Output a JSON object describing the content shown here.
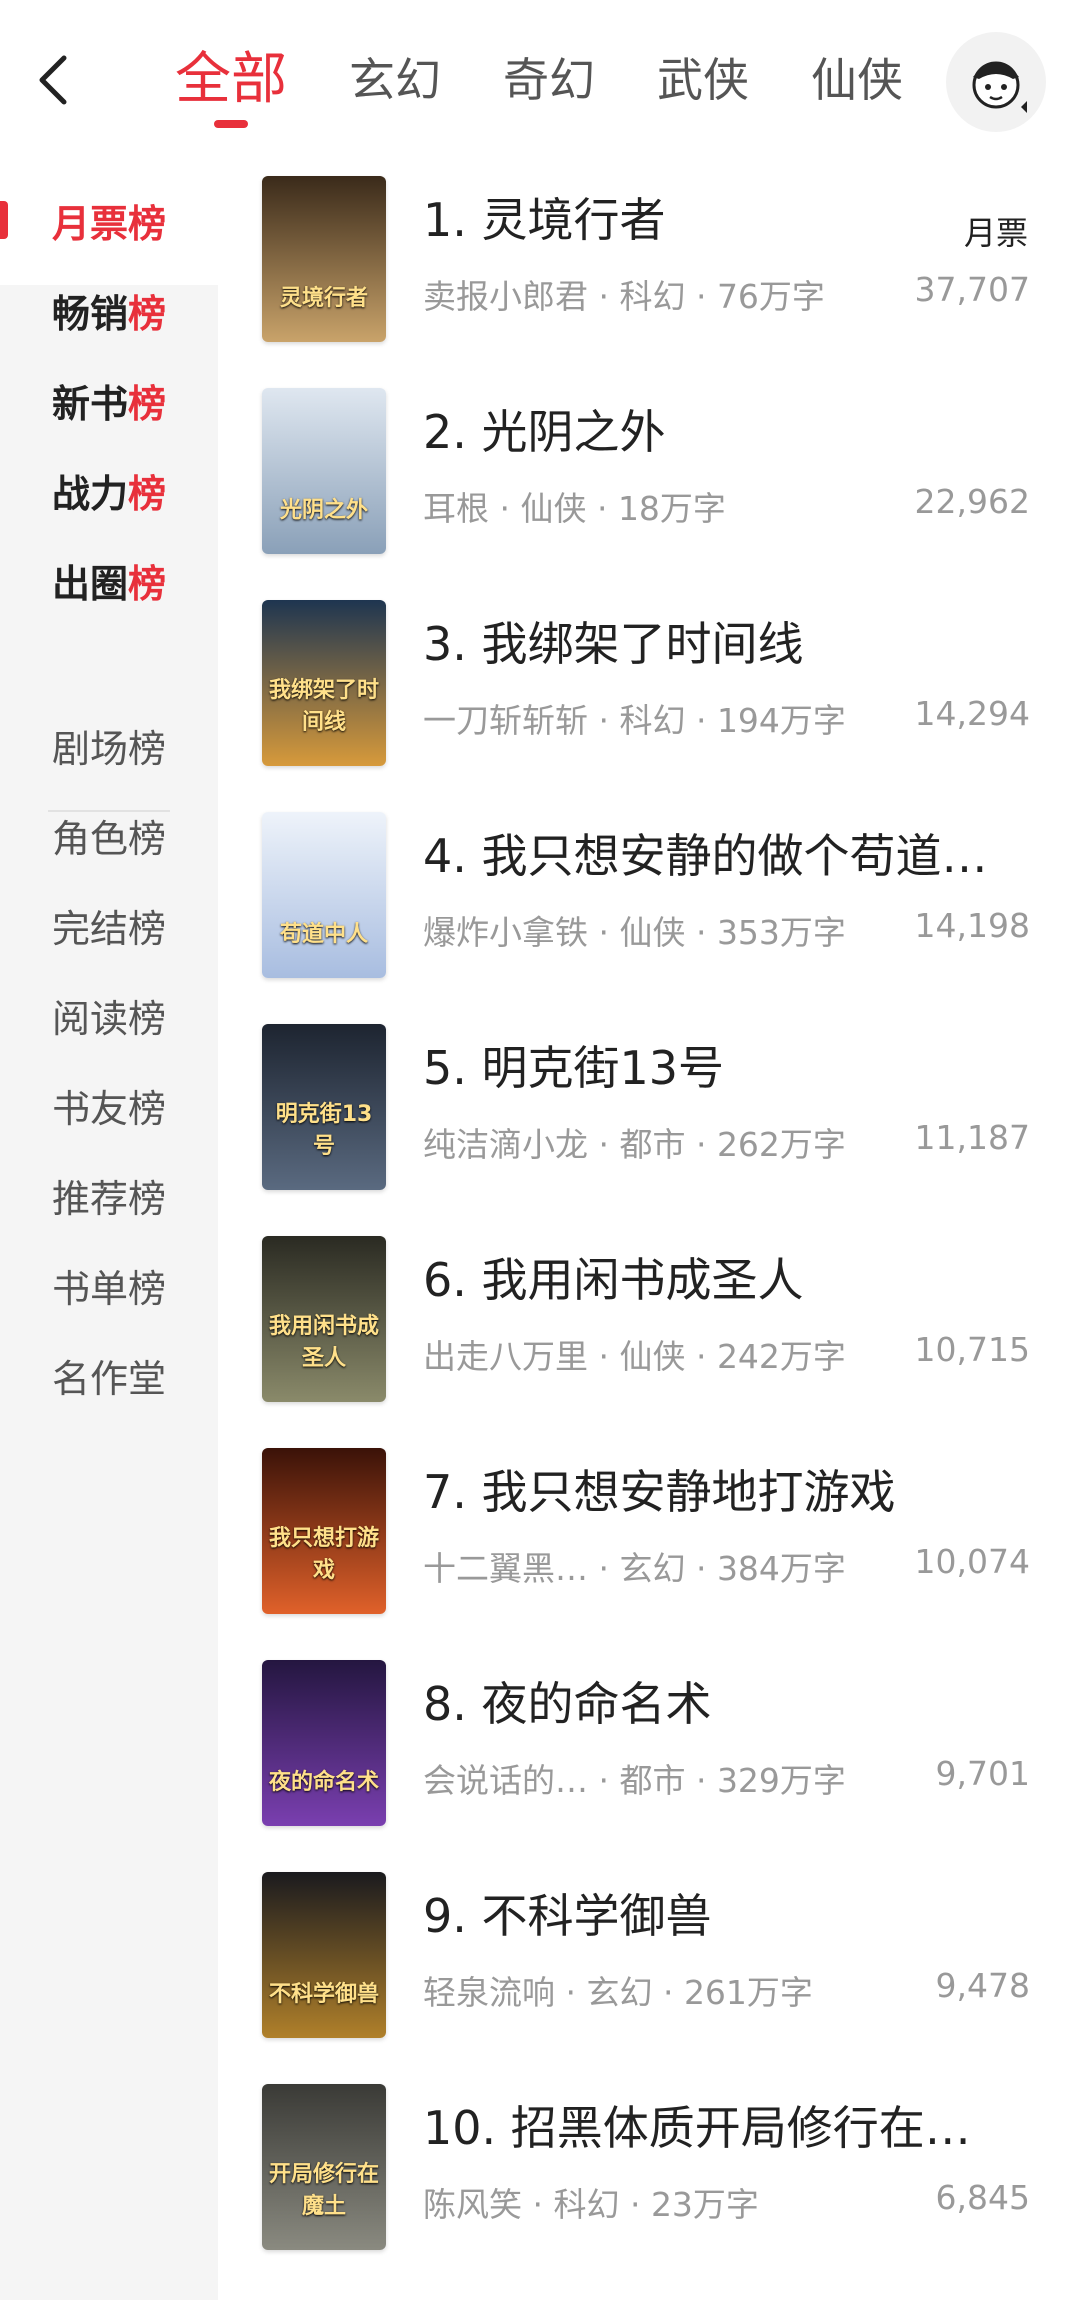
{
  "header": {
    "tabs": [
      "全部",
      "玄幻",
      "奇幻",
      "武侠",
      "仙侠"
    ],
    "active_tab": 0
  },
  "sidebar": {
    "items": [
      {
        "label": "月票",
        "suffix": "榜",
        "style": "active"
      },
      {
        "label": "畅销",
        "suffix": "榜",
        "style": "bold"
      },
      {
        "label": "新书",
        "suffix": "榜",
        "style": "bold"
      },
      {
        "label": "战力",
        "suffix": "榜",
        "style": "bold"
      },
      {
        "label": "出圈",
        "suffix": "榜",
        "style": "bold"
      },
      {
        "label": "剧场榜",
        "suffix": "",
        "style": "normal"
      },
      {
        "label": "角色榜",
        "suffix": "",
        "style": "normal"
      },
      {
        "label": "完结榜",
        "suffix": "",
        "style": "normal"
      },
      {
        "label": "阅读榜",
        "suffix": "",
        "style": "normal"
      },
      {
        "label": "书友榜",
        "suffix": "",
        "style": "normal"
      },
      {
        "label": "推荐榜",
        "suffix": "",
        "style": "normal"
      },
      {
        "label": "书单榜",
        "suffix": "",
        "style": "normal"
      },
      {
        "label": "名作堂",
        "suffix": "",
        "style": "normal"
      }
    ]
  },
  "list": {
    "votes_label": "月票",
    "books": [
      {
        "title": "1. 灵境行者",
        "meta": "卖报小郎君 · 科幻 · 76万字",
        "votes": "37,707",
        "cover_text": "灵境行者",
        "cover_colors": [
          "#3a2a1a",
          "#c9a36a"
        ]
      },
      {
        "title": "2. 光阴之外",
        "meta": "耳根 · 仙侠 · 18万字",
        "votes": "22,962",
        "cover_text": "光阴之外",
        "cover_colors": [
          "#dfe7f0",
          "#8aa0b8"
        ]
      },
      {
        "title": "3. 我绑架了时间线",
        "meta": "一刀斩斩斩 · 科幻 · 194万字",
        "votes": "14,294",
        "cover_text": "我绑架了时间线",
        "cover_colors": [
          "#1e3550",
          "#d79a3b"
        ]
      },
      {
        "title": "4. 我只想安静的做个苟道…",
        "meta": "爆炸小拿铁 · 仙侠 · 353万字",
        "votes": "14,198",
        "cover_text": "苟道中人",
        "cover_colors": [
          "#eef3fa",
          "#a8bde0"
        ]
      },
      {
        "title": "5. 明克街13号",
        "meta": "纯洁滴小龙 · 都市 · 262万字",
        "votes": "11,187",
        "cover_text": "明克街13号",
        "cover_colors": [
          "#1d2430",
          "#5a6a80"
        ]
      },
      {
        "title": "6. 我用闲书成圣人",
        "meta": "出走八万里 · 仙侠 · 242万字",
        "votes": "10,715",
        "cover_text": "我用闲书成圣人",
        "cover_colors": [
          "#2a2a22",
          "#8a8a6a"
        ]
      },
      {
        "title": "7. 我只想安静地打游戏",
        "meta": "十二翼黑… · 玄幻 · 384万字",
        "votes": "10,074",
        "cover_text": "我只想打游戏",
        "cover_colors": [
          "#3a1208",
          "#e0612a"
        ]
      },
      {
        "title": "8. 夜的命名术",
        "meta": "会说话的…  · 都市 · 329万字",
        "votes": "9,701",
        "cover_text": "夜的命名术",
        "cover_colors": [
          "#241640",
          "#7a3fb0"
        ]
      },
      {
        "title": "9. 不科学御兽",
        "meta": "轻泉流响 · 玄幻 · 261万字",
        "votes": "9,478",
        "cover_text": "不科学御兽",
        "cover_colors": [
          "#1a1a1e",
          "#b0802a"
        ]
      },
      {
        "title": "10. 招黑体质开局修行在…",
        "meta": "陈风笑 · 科幻 · 23万字",
        "votes": "6,845",
        "cover_text": "开局修行在魔土",
        "cover_colors": [
          "#3a3a36",
          "#8a8a80"
        ]
      }
    ]
  }
}
